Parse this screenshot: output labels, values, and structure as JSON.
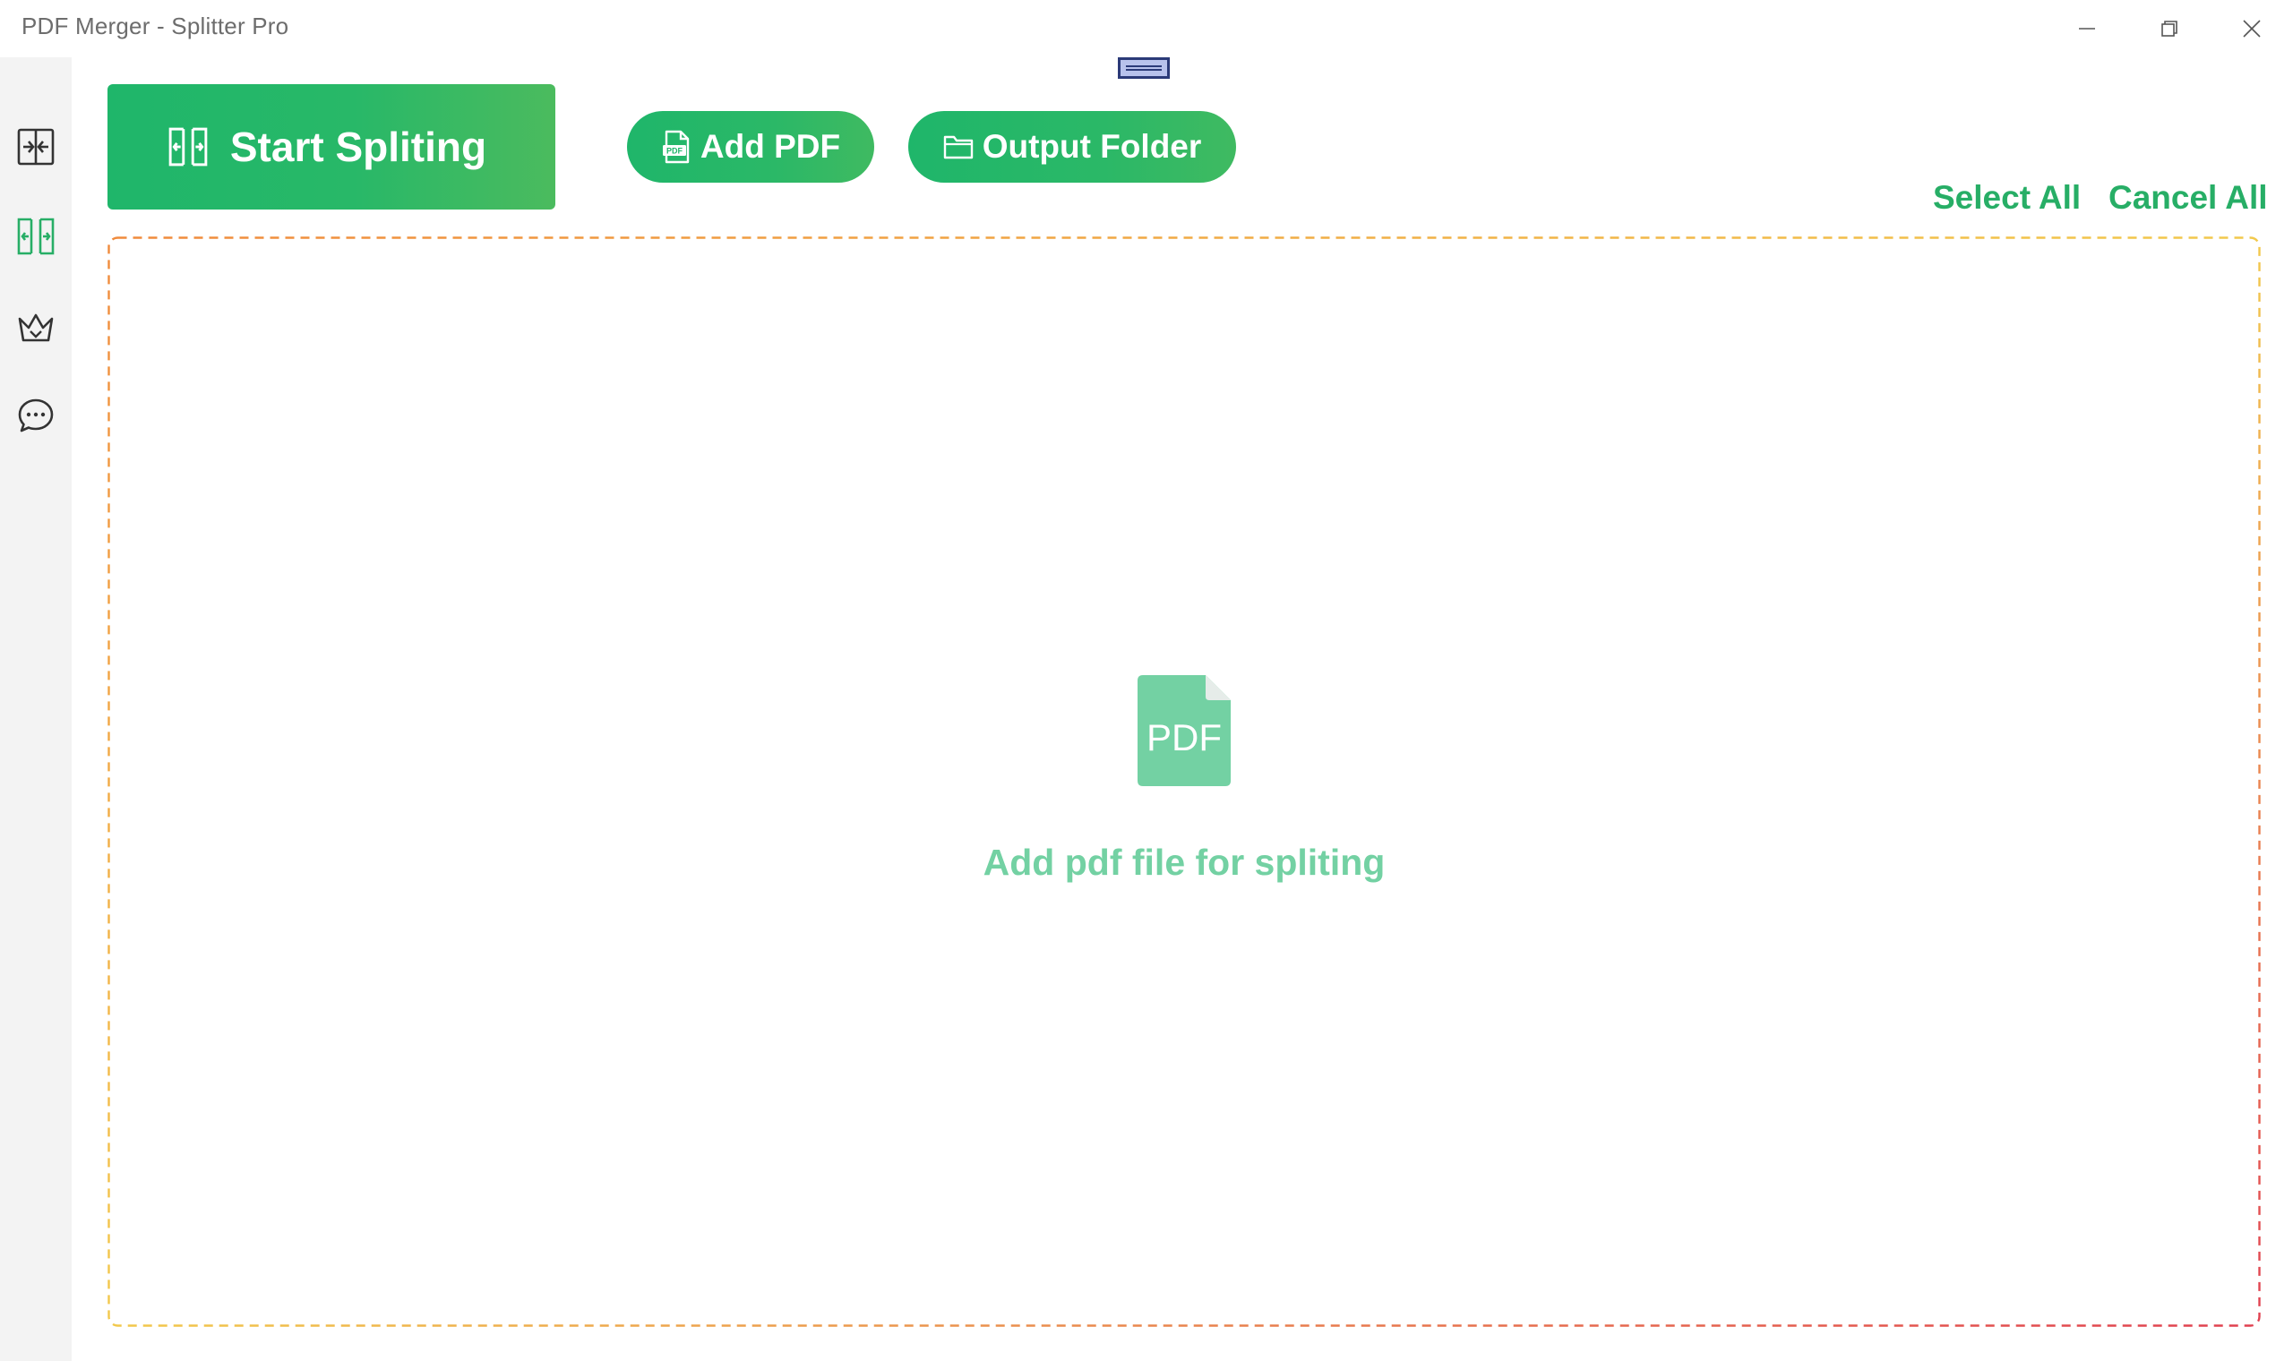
{
  "window": {
    "title": "PDF Merger - Splitter Pro",
    "controls": [
      "minimize",
      "restore",
      "close"
    ]
  },
  "sidebar": {
    "items": [
      {
        "name": "merge",
        "icon": "merge-icon",
        "active": false
      },
      {
        "name": "split",
        "icon": "split-icon",
        "active": true
      },
      {
        "name": "premium",
        "icon": "crown-icon",
        "active": false
      },
      {
        "name": "feedback",
        "icon": "chat-bubble-icon",
        "active": false
      }
    ]
  },
  "toolbar": {
    "start_label": "Start Spliting",
    "add_pdf_label": "Add PDF",
    "output_folder_label": "Output Folder",
    "select_all_label": "Select All",
    "cancel_all_label": "Cancel All"
  },
  "dropzone": {
    "icon_text": "PDF",
    "message": "Add pdf file for spliting"
  },
  "colors": {
    "accent": "#27ae66",
    "accent_light": "#73d1a3",
    "sidebar_bg": "#f3f3f3",
    "border_gradient": [
      "#f08a3c",
      "#f2c94c",
      "#e04050"
    ]
  }
}
